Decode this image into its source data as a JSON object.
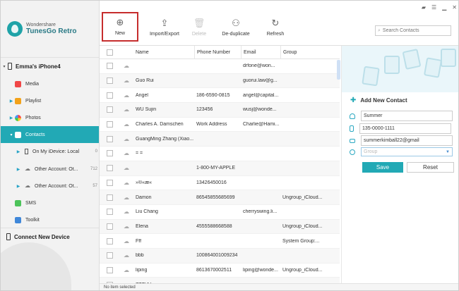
{
  "sidebar": {
    "brand_small": "Wondershare",
    "brand_name": "TunesGo Retro",
    "device": "Emma's iPhone4",
    "items": [
      {
        "label": "Media"
      },
      {
        "label": "Playlist"
      },
      {
        "label": "Photos"
      },
      {
        "label": "Contacts"
      },
      {
        "label": "On My iDevice: Local",
        "count": "0"
      },
      {
        "label": "Other Account: Ot...",
        "count": "712"
      },
      {
        "label": "Other Account: Ot...",
        "count": "57"
      },
      {
        "label": "SMS"
      },
      {
        "label": "Toolkit"
      }
    ],
    "connect_new": "Connect New Device"
  },
  "toolbar": {
    "new": "New",
    "import_export": "Import/Export",
    "delete": "Delete",
    "deduplicate": "De-duplicate",
    "refresh": "Refresh",
    "search_placeholder": "Search Contacts"
  },
  "table": {
    "headers": {
      "name": "Name",
      "phone": "Phone Number",
      "email": "Email",
      "group": "Group"
    },
    "rows": [
      {
        "name": "",
        "phone": "",
        "email": "drfone@won...",
        "group": ""
      },
      {
        "name": "Guo Rui",
        "phone": "",
        "email": "guorui.law@g...",
        "group": ""
      },
      {
        "name": "Angel",
        "phone": "186-6590-0815",
        "email": "angel@capital...",
        "group": ""
      },
      {
        "name": "WU  Sujin",
        "phone": "123456",
        "email": "wusj@wonde...",
        "group": ""
      },
      {
        "name": "Charles A. Damschen",
        "phone": "Work Address",
        "email": "Charlie@Hami...",
        "group": ""
      },
      {
        "name": "GuangMing  Zhang (Xiao...",
        "phone": "",
        "email": "",
        "group": ""
      },
      {
        "name": "= =",
        "phone": "",
        "email": "",
        "group": ""
      },
      {
        "name": "",
        "phone": "1-800-MY-APPLE",
        "email": "",
        "group": ""
      },
      {
        "name": "»®«æ«",
        "phone": "13426450016",
        "email": "",
        "group": ""
      },
      {
        "name": "Damon",
        "phone": "86545855685699",
        "email": "",
        "group": "Ungroup_iCloud..."
      },
      {
        "name": "Liu Chang",
        "phone": "",
        "email": "cherryswing.li...",
        "group": ""
      },
      {
        "name": "Elena",
        "phone": "4555588668588",
        "email": "",
        "group": "Ungroup_iCloud..."
      },
      {
        "name": "Fff",
        "phone": "",
        "email": "",
        "group": "System Group:..."
      },
      {
        "name": "bbb",
        "phone": "100864001009234",
        "email": "",
        "group": ""
      },
      {
        "name": "liping",
        "phone": "8613670002511",
        "email": "liping@wonde...",
        "group": "Ungroup_iCloud..."
      },
      {
        "name": "ZZZVV",
        "phone": "",
        "email": "",
        "group": ""
      }
    ]
  },
  "panel": {
    "title": "Add New Contact",
    "name_value": "Summer",
    "phone_value": "135-0000-1111",
    "email_value": "summerkimball22@gmail",
    "group_placeholder": "Group",
    "save": "Save",
    "reset": "Reset"
  },
  "status": "No item selected",
  "colors": {
    "accent": "#22a9b5",
    "highlight_border": "#c62d2d"
  }
}
